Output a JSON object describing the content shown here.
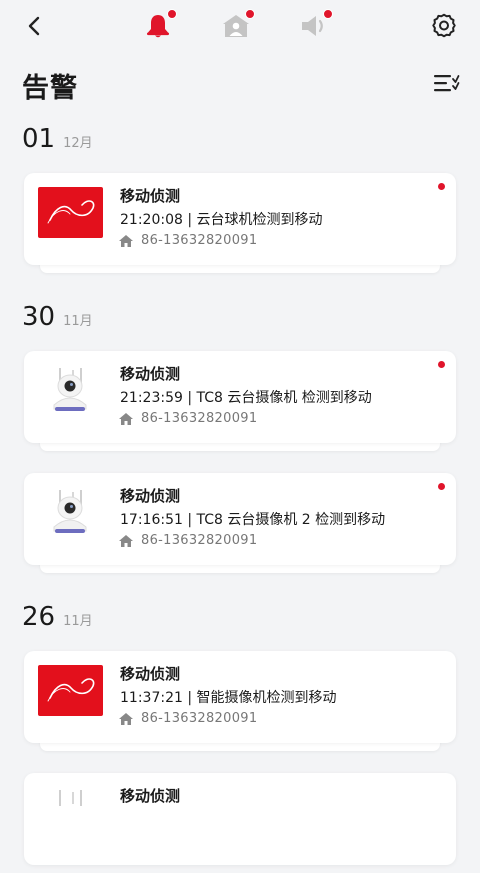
{
  "header": {
    "tabs": [
      {
        "name": "alarm-tab",
        "icon": "bell-icon"
      },
      {
        "name": "visitor-tab",
        "icon": "house-person-icon"
      },
      {
        "name": "message-tab",
        "icon": "speaker-icon"
      }
    ],
    "accent_color": "#e0152b"
  },
  "page": {
    "title": "告警"
  },
  "groups": [
    {
      "day": "01",
      "month": "12月",
      "events": [
        {
          "title": "移动侦测",
          "detail": "21:20:08 | 云台球机检测到移动",
          "device": "86-13632820091",
          "thumb": "brand-logo",
          "unread": true
        }
      ]
    },
    {
      "day": "30",
      "month": "11月",
      "events": [
        {
          "title": "移动侦测",
          "detail": "21:23:59 | TC8 云台摄像机 检测到移动",
          "device": "86-13632820091",
          "thumb": "camera",
          "unread": true
        },
        {
          "title": "移动侦测",
          "detail": "17:16:51 | TC8 云台摄像机 2 检测到移动",
          "device": "86-13632820091",
          "thumb": "camera",
          "unread": true
        }
      ]
    },
    {
      "day": "26",
      "month": "11月",
      "events": [
        {
          "title": "移动侦测",
          "detail": "11:37:21 | 智能摄像机检测到移动",
          "device": "86-13632820091",
          "thumb": "brand-logo",
          "unread": false
        },
        {
          "title": "移动侦测",
          "detail": "",
          "device": "",
          "thumb": "camera",
          "unread": false
        }
      ]
    }
  ]
}
